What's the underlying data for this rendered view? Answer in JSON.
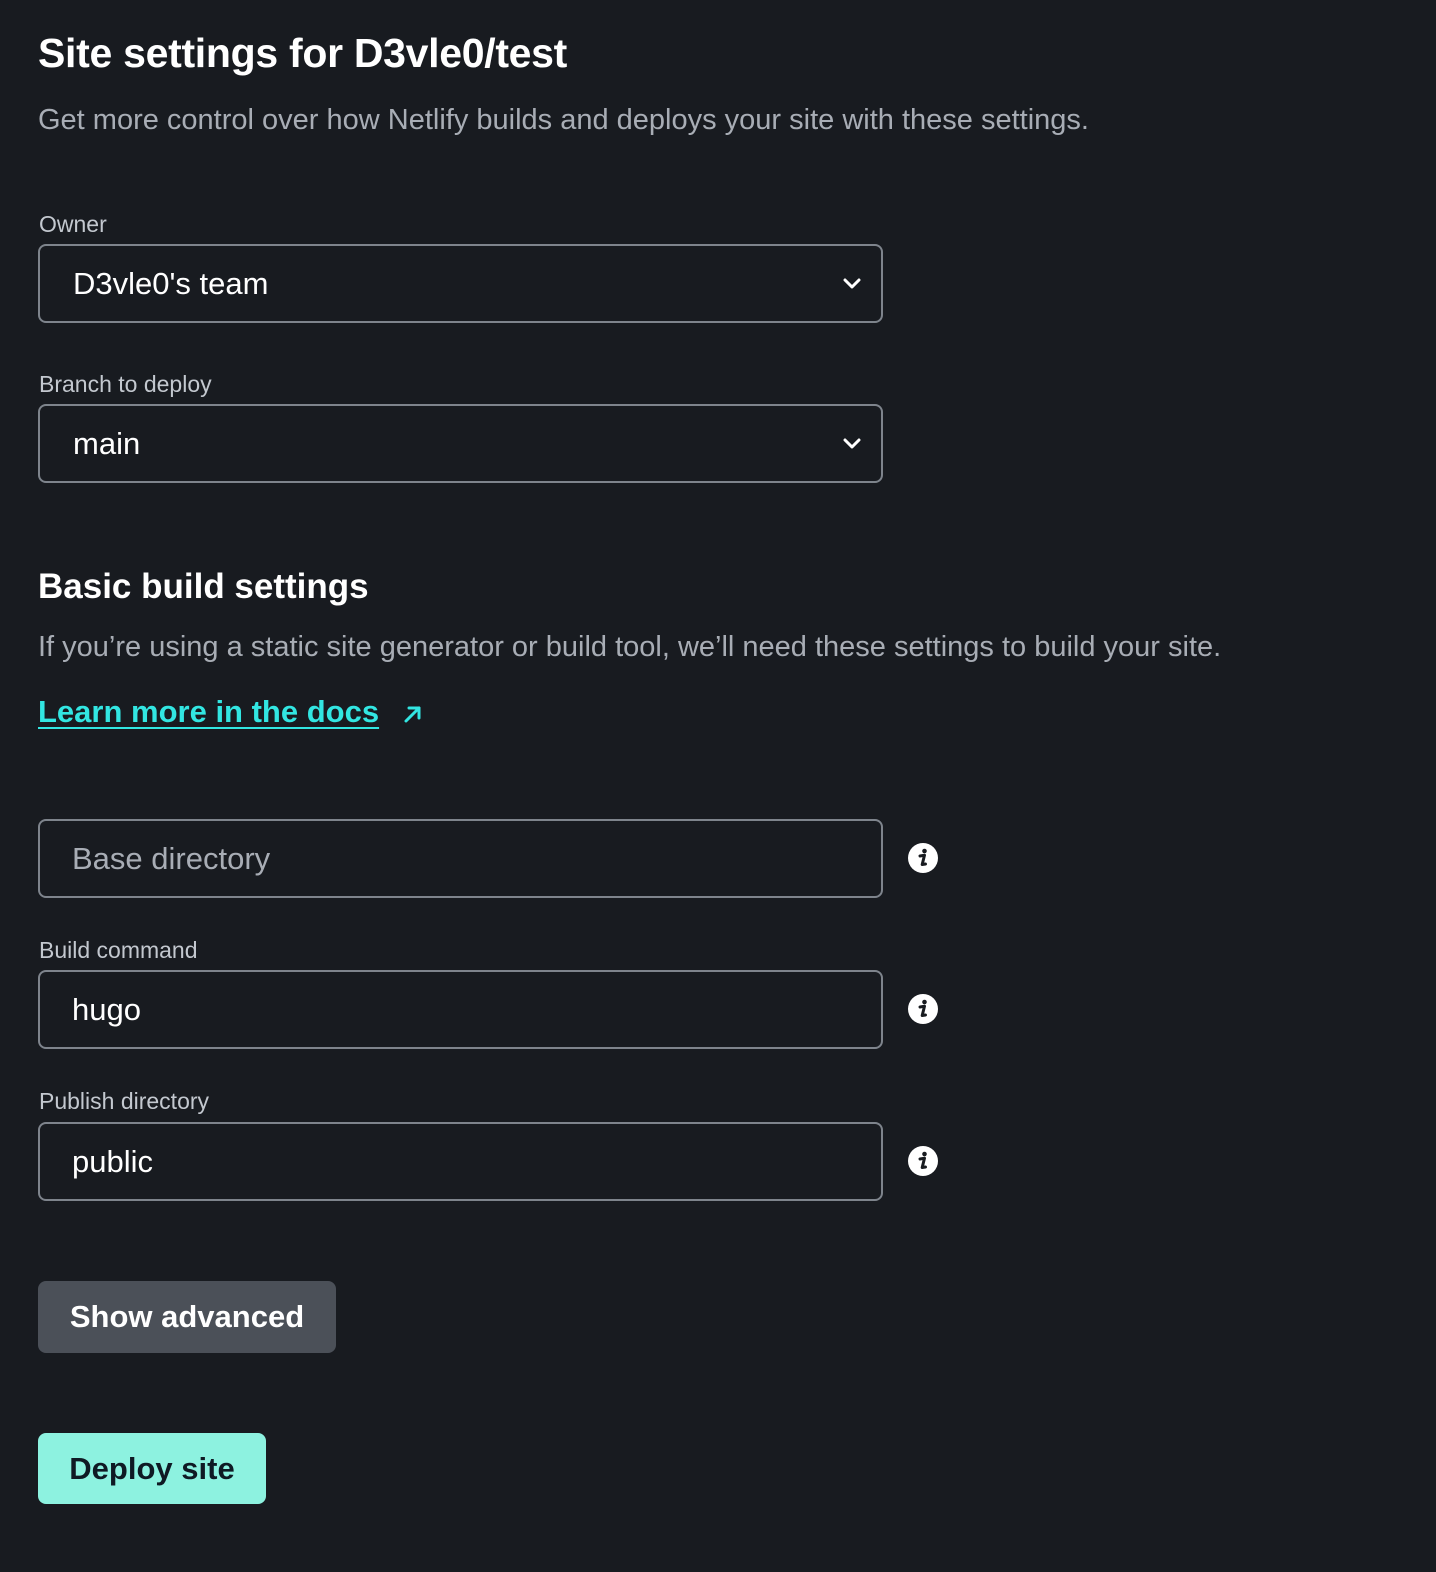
{
  "header": {
    "title": "Site settings for D3vle0/test",
    "subtitle": "Get more control over how Netlify builds and deploys your site with these settings."
  },
  "owner": {
    "label": "Owner",
    "value": "D3vle0's team"
  },
  "branch": {
    "label": "Branch to deploy",
    "value": "main"
  },
  "build_settings": {
    "title": "Basic build settings",
    "description": "If you’re using a static site generator or build tool, we’ll need these settings to build your site.",
    "docs_link": "Learn more in the docs",
    "base_directory": {
      "placeholder": "Base directory",
      "value": ""
    },
    "build_command": {
      "label": "Build command",
      "value": "hugo"
    },
    "publish_directory": {
      "label": "Publish directory",
      "value": "public"
    }
  },
  "actions": {
    "show_advanced": "Show advanced",
    "deploy": "Deploy site"
  },
  "colors": {
    "background": "#181b20",
    "link": "#32e6e2",
    "primary_button": "#8df2e0",
    "secondary_button": "#4b5058"
  },
  "icons": {
    "chevron": "chevron-down-icon",
    "info": "info-icon",
    "external_link": "external-link-icon"
  }
}
